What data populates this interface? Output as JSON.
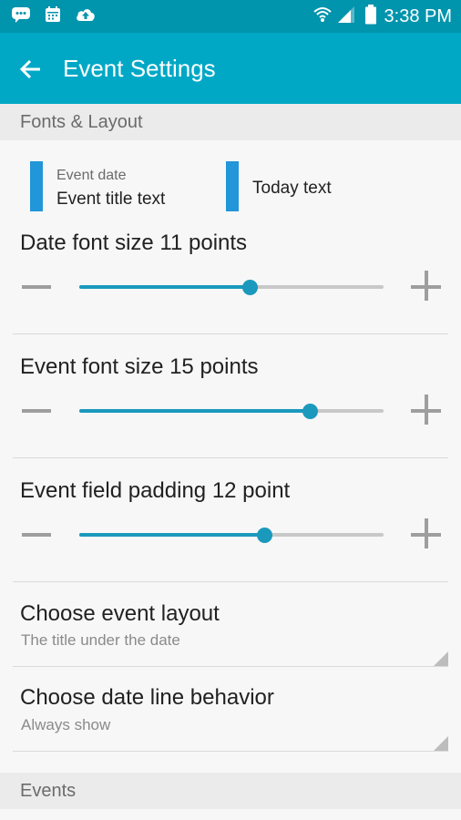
{
  "status_bar": {
    "time": "3:38 PM",
    "icons_left": [
      "chat-icon",
      "calendar-icon",
      "cloud-upload-icon"
    ],
    "icons_right": [
      "wifi-icon",
      "signal-icon",
      "battery-icon"
    ]
  },
  "app_bar": {
    "title": "Event Settings",
    "back_icon": "arrow-back-icon"
  },
  "sections": {
    "fonts_layout": "Fonts & Layout",
    "events": "Events"
  },
  "preview": {
    "event_date": "Event date",
    "event_title": "Event title text",
    "today_text": "Today text"
  },
  "settings": {
    "date_font_size": {
      "label": "Date font size 11 points",
      "value": 0.56
    },
    "event_font_size": {
      "label": "Event font size 15 points",
      "value": 0.758
    },
    "event_field_padding": {
      "label": "Event field padding 12 point",
      "value": 0.61
    }
  },
  "prefs": {
    "event_layout": {
      "title": "Choose event layout",
      "summary": "The title under the date"
    },
    "date_line": {
      "title": "Choose date line behavior",
      "summary": "Always show"
    }
  },
  "colors": {
    "status_bar": "#0094ad",
    "app_bar": "#00a8c6",
    "accent": "#1a99bd",
    "preview_bar": "#2196d9"
  }
}
